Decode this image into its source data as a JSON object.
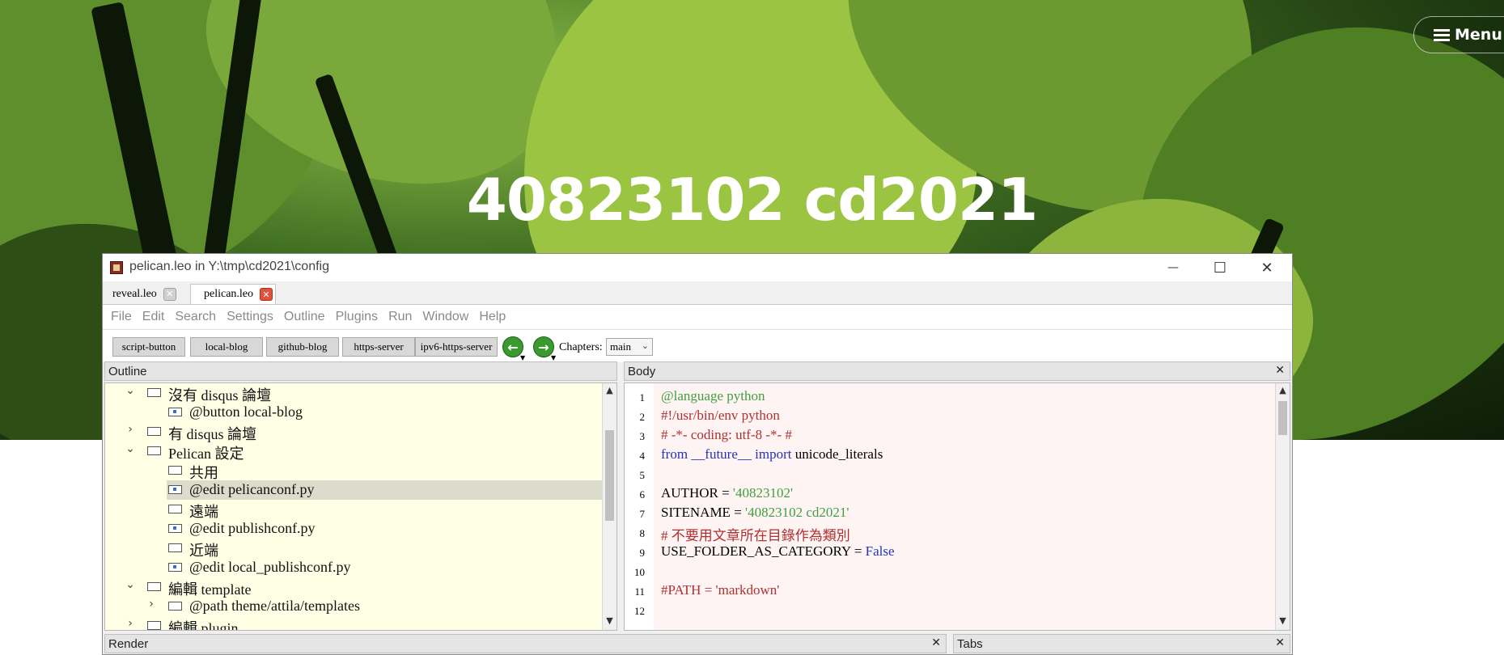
{
  "site": {
    "title": "40823102 cd2021",
    "menu_label": "Menu",
    "menu_icon": "hamburger-icon"
  },
  "window": {
    "title": "pelican.leo in Y:\\tmp\\cd2021\\config",
    "controls": {
      "minimize": "—",
      "maximize": "☐",
      "close": "✕"
    }
  },
  "file_tabs": [
    {
      "label": "reveal.leo",
      "close": "✕"
    },
    {
      "label": "pelican.leo",
      "close": "✕"
    }
  ],
  "menu": [
    "File",
    "Edit",
    "Search",
    "Settings",
    "Outline",
    "Plugins",
    "Run",
    "Window",
    "Help"
  ],
  "toolbar": {
    "buttons": [
      "script-button",
      "local-blog",
      "github-blog",
      "https-server",
      "ipv6-https-server"
    ],
    "back_icon": "←",
    "forward_icon": "→",
    "chapters_label": "Chapters:",
    "chapter_value": "main"
  },
  "outline": {
    "header": "Outline",
    "rows": [
      {
        "label": "沒有 disqus 論壇",
        "chevron": "⌄",
        "marked": false
      },
      {
        "label": "@button local-blog",
        "chevron": "",
        "marked": true
      },
      {
        "label": "有 disqus 論壇",
        "chevron": "›",
        "marked": false
      },
      {
        "label": "Pelican 設定",
        "chevron": "⌄",
        "marked": false
      },
      {
        "label": "共用",
        "chevron": "",
        "marked": false
      },
      {
        "label": "@edit pelicanconf.py",
        "chevron": "",
        "marked": true
      },
      {
        "label": "遠端",
        "chevron": "",
        "marked": false
      },
      {
        "label": "@edit publishconf.py",
        "chevron": "",
        "marked": true
      },
      {
        "label": "近端",
        "chevron": "",
        "marked": false
      },
      {
        "label": "@edit local_publishconf.py",
        "chevron": "",
        "marked": true
      },
      {
        "label": "編輯 template",
        "chevron": "⌄",
        "marked": false
      },
      {
        "label": "@path theme/attila/templates",
        "chevron": "›",
        "marked": false
      },
      {
        "label": "編輯 plugin",
        "chevron": "›",
        "marked": false
      }
    ]
  },
  "body": {
    "header": "Body",
    "close": "✕",
    "line_numbers": [
      "1",
      "2",
      "3",
      "4",
      "5",
      "6",
      "7",
      "8",
      "9",
      "10",
      "11",
      "12"
    ],
    "lines": [
      [
        {
          "t": "@language python",
          "c": "dir"
        }
      ],
      [
        {
          "t": "#!/usr/bin/env python",
          "c": "com"
        }
      ],
      [
        {
          "t": "# -*- coding: utf-8 -*- #",
          "c": "com"
        }
      ],
      [
        {
          "t": "from",
          "c": "kw"
        },
        {
          "t": " __future__ ",
          "c": "kw"
        },
        {
          "t": "import",
          "c": "kw"
        },
        {
          "t": " unicode_literals",
          "c": "norm"
        }
      ],
      [],
      [
        {
          "t": "AUTHOR = ",
          "c": "norm"
        },
        {
          "t": "'40823102'",
          "c": "str"
        }
      ],
      [
        {
          "t": "SITENAME = ",
          "c": "norm"
        },
        {
          "t": "'40823102 cd2021'",
          "c": "str"
        }
      ],
      [
        {
          "t": "# 不要用文章所在目錄作為類別",
          "c": "com"
        }
      ],
      [
        {
          "t": "USE_FOLDER_AS_CATEGORY = ",
          "c": "norm"
        },
        {
          "t": "False",
          "c": "kw"
        }
      ],
      [],
      [
        {
          "t": "#PATH = 'markdown'",
          "c": "com"
        }
      ],
      []
    ]
  },
  "render_pane": {
    "header": "Render",
    "close": "✕"
  },
  "tabs_pane": {
    "header": "Tabs",
    "close": "✕"
  },
  "colors": {
    "outline_bg": "#ffffe6",
    "body_bg": "#fff4f4",
    "selected_row": "#dcdccc",
    "code_green": "#3f9f3f",
    "code_red": "#b03030",
    "code_blue": "#2233b8"
  }
}
